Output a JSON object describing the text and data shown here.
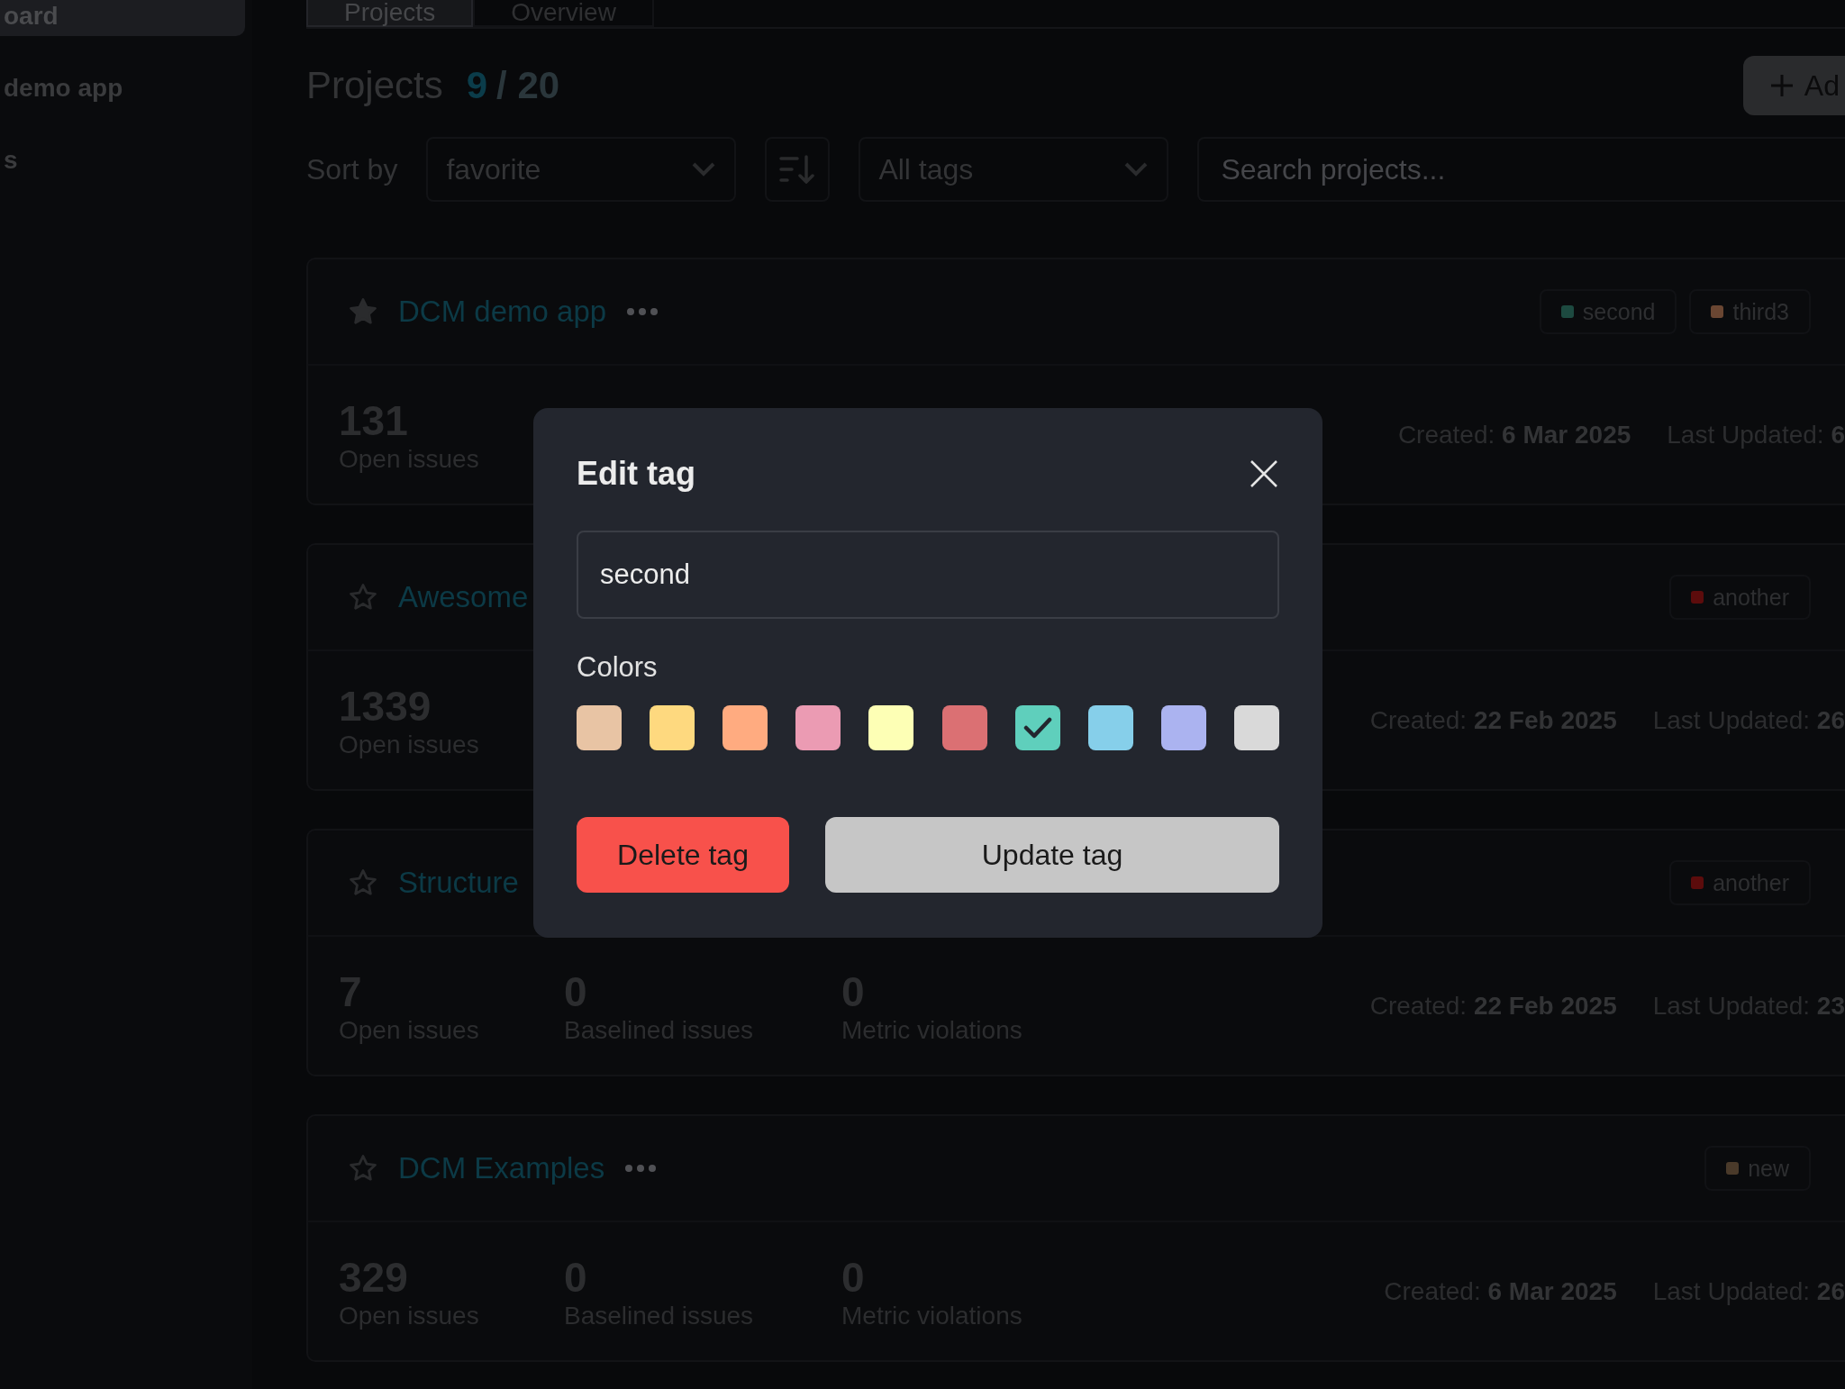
{
  "sidebar": {
    "items": [
      {
        "label": "oard",
        "selected": true
      },
      {
        "label": "demo app",
        "selected": false
      },
      {
        "label": "s",
        "selected": false
      }
    ]
  },
  "tabs": [
    {
      "label": "Projects",
      "selected": true
    },
    {
      "label": "Overview",
      "selected": false
    }
  ],
  "header": {
    "title": "Projects",
    "shown": "9",
    "total": "/ 20",
    "add_button": "Ad"
  },
  "filters": {
    "sort_label": "Sort by",
    "sort_value": "favorite",
    "tags_value": "All tags",
    "search_placeholder": "Search projects..."
  },
  "projects": [
    {
      "name": "DCM demo app",
      "favorite": true,
      "menu_icon": true,
      "tags": [
        {
          "label": "second",
          "color": "#1d4a40"
        },
        {
          "label": "third3",
          "color": "#6a4632"
        }
      ],
      "stats": [
        {
          "value": "131",
          "label": "Open issues"
        }
      ],
      "created_label": "Created:",
      "created": "6 Mar 2025",
      "updated_label": "Last Updated:",
      "updated": "6"
    },
    {
      "name": "Awesome",
      "favorite": false,
      "menu_icon": false,
      "tags": [
        {
          "label": "another",
          "color": "#5c0c0c"
        }
      ],
      "stats": [
        {
          "value": "1339",
          "label": "Open issues"
        }
      ],
      "created_label": "Created:",
      "created": "22 Feb 2025",
      "updated_label": "Last Updated:",
      "updated": "26"
    },
    {
      "name": "Structure",
      "favorite": false,
      "menu_icon": false,
      "tags": [
        {
          "label": "another",
          "color": "#5c0c0c"
        }
      ],
      "stats": [
        {
          "value": "7",
          "label": "Open issues"
        },
        {
          "value": "0",
          "label": "Baselined issues"
        },
        {
          "value": "0",
          "label": "Metric violations"
        }
      ],
      "created_label": "Created:",
      "created": "22 Feb 2025",
      "updated_label": "Last Updated:",
      "updated": "23"
    },
    {
      "name": "DCM Examples",
      "favorite": false,
      "menu_icon": true,
      "tags": [
        {
          "label": "new",
          "color": "#4a3a2a"
        }
      ],
      "stats": [
        {
          "value": "329",
          "label": "Open issues"
        },
        {
          "value": "0",
          "label": "Baselined issues"
        },
        {
          "value": "0",
          "label": "Metric violations"
        }
      ],
      "created_label": "Created:",
      "created": "6 Mar 2025",
      "updated_label": "Last Updated:",
      "updated": "26"
    }
  ],
  "modal": {
    "title": "Edit tag",
    "tag_name": "second",
    "colors_label": "Colors",
    "colors": [
      {
        "color": "#e8c4a4",
        "selected": false
      },
      {
        "color": "#fed97f",
        "selected": false
      },
      {
        "color": "#ffab80",
        "selected": false
      },
      {
        "color": "#eb9bb3",
        "selected": false
      },
      {
        "color": "#fdffb5",
        "selected": false
      },
      {
        "color": "#db7073",
        "selected": false
      },
      {
        "color": "#5fcfbc",
        "selected": true
      },
      {
        "color": "#86cfea",
        "selected": false
      },
      {
        "color": "#abb3f0",
        "selected": false
      },
      {
        "color": "#d9d9d9",
        "selected": false
      }
    ],
    "delete_button": "Delete tag",
    "update_button": "Update tag"
  }
}
